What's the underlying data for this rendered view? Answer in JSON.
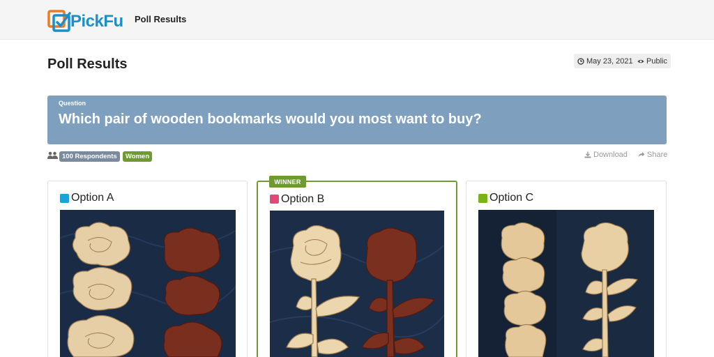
{
  "header": {
    "brand": "PickFu",
    "nav_title": "Poll Results"
  },
  "page": {
    "title": "Poll Results",
    "date": "May 23, 2021",
    "visibility": "Public"
  },
  "question": {
    "label": "Question",
    "text": "Which pair of wooden bookmarks would you most want to buy?"
  },
  "audience": {
    "respondents": "100 Respondents",
    "segment": "Women"
  },
  "actions": {
    "download": "Download",
    "share": "Share"
  },
  "options": [
    {
      "label": "Option A",
      "color": "#1ba3d6"
    },
    {
      "label": "Option B",
      "color": "#e04a78",
      "winner": "WINNER"
    },
    {
      "label": "Option C",
      "color": "#7ab317"
    }
  ],
  "colors": {
    "accent_blue": "#1b8fc9",
    "question_bg": "#7f9fbf",
    "winner_green": "#6f9a32",
    "badge_gray": "#7a8aa0"
  },
  "icons": {
    "logo": "checkbox-logo-icon",
    "date": "clock-icon",
    "public": "eye-icon",
    "people": "users-icon",
    "download": "download-icon",
    "share": "share-icon"
  }
}
